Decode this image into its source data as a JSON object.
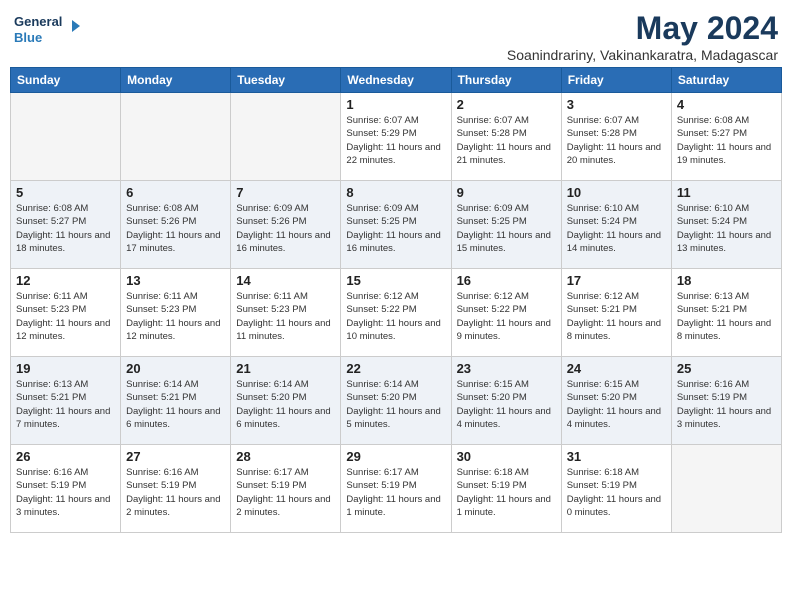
{
  "header": {
    "logo_line1": "General",
    "logo_line2": "Blue",
    "month": "May 2024",
    "location": "Soanindrariny, Vakinankaratra, Madagascar"
  },
  "days_of_week": [
    "Sunday",
    "Monday",
    "Tuesday",
    "Wednesday",
    "Thursday",
    "Friday",
    "Saturday"
  ],
  "weeks": [
    {
      "shade": "odd",
      "days": [
        {
          "num": "",
          "empty": true
        },
        {
          "num": "",
          "empty": true
        },
        {
          "num": "",
          "empty": true
        },
        {
          "num": "1",
          "sunrise": "6:07 AM",
          "sunset": "5:29 PM",
          "daylight": "11 hours and 22 minutes."
        },
        {
          "num": "2",
          "sunrise": "6:07 AM",
          "sunset": "5:28 PM",
          "daylight": "11 hours and 21 minutes."
        },
        {
          "num": "3",
          "sunrise": "6:07 AM",
          "sunset": "5:28 PM",
          "daylight": "11 hours and 20 minutes."
        },
        {
          "num": "4",
          "sunrise": "6:08 AM",
          "sunset": "5:27 PM",
          "daylight": "11 hours and 19 minutes."
        }
      ]
    },
    {
      "shade": "even",
      "days": [
        {
          "num": "5",
          "sunrise": "6:08 AM",
          "sunset": "5:27 PM",
          "daylight": "11 hours and 18 minutes."
        },
        {
          "num": "6",
          "sunrise": "6:08 AM",
          "sunset": "5:26 PM",
          "daylight": "11 hours and 17 minutes."
        },
        {
          "num": "7",
          "sunrise": "6:09 AM",
          "sunset": "5:26 PM",
          "daylight": "11 hours and 16 minutes."
        },
        {
          "num": "8",
          "sunrise": "6:09 AM",
          "sunset": "5:25 PM",
          "daylight": "11 hours and 16 minutes."
        },
        {
          "num": "9",
          "sunrise": "6:09 AM",
          "sunset": "5:25 PM",
          "daylight": "11 hours and 15 minutes."
        },
        {
          "num": "10",
          "sunrise": "6:10 AM",
          "sunset": "5:24 PM",
          "daylight": "11 hours and 14 minutes."
        },
        {
          "num": "11",
          "sunrise": "6:10 AM",
          "sunset": "5:24 PM",
          "daylight": "11 hours and 13 minutes."
        }
      ]
    },
    {
      "shade": "odd",
      "days": [
        {
          "num": "12",
          "sunrise": "6:11 AM",
          "sunset": "5:23 PM",
          "daylight": "11 hours and 12 minutes."
        },
        {
          "num": "13",
          "sunrise": "6:11 AM",
          "sunset": "5:23 PM",
          "daylight": "11 hours and 12 minutes."
        },
        {
          "num": "14",
          "sunrise": "6:11 AM",
          "sunset": "5:23 PM",
          "daylight": "11 hours and 11 minutes."
        },
        {
          "num": "15",
          "sunrise": "6:12 AM",
          "sunset": "5:22 PM",
          "daylight": "11 hours and 10 minutes."
        },
        {
          "num": "16",
          "sunrise": "6:12 AM",
          "sunset": "5:22 PM",
          "daylight": "11 hours and 9 minutes."
        },
        {
          "num": "17",
          "sunrise": "6:12 AM",
          "sunset": "5:21 PM",
          "daylight": "11 hours and 8 minutes."
        },
        {
          "num": "18",
          "sunrise": "6:13 AM",
          "sunset": "5:21 PM",
          "daylight": "11 hours and 8 minutes."
        }
      ]
    },
    {
      "shade": "even",
      "days": [
        {
          "num": "19",
          "sunrise": "6:13 AM",
          "sunset": "5:21 PM",
          "daylight": "11 hours and 7 minutes."
        },
        {
          "num": "20",
          "sunrise": "6:14 AM",
          "sunset": "5:21 PM",
          "daylight": "11 hours and 6 minutes."
        },
        {
          "num": "21",
          "sunrise": "6:14 AM",
          "sunset": "5:20 PM",
          "daylight": "11 hours and 6 minutes."
        },
        {
          "num": "22",
          "sunrise": "6:14 AM",
          "sunset": "5:20 PM",
          "daylight": "11 hours and 5 minutes."
        },
        {
          "num": "23",
          "sunrise": "6:15 AM",
          "sunset": "5:20 PM",
          "daylight": "11 hours and 4 minutes."
        },
        {
          "num": "24",
          "sunrise": "6:15 AM",
          "sunset": "5:20 PM",
          "daylight": "11 hours and 4 minutes."
        },
        {
          "num": "25",
          "sunrise": "6:16 AM",
          "sunset": "5:19 PM",
          "daylight": "11 hours and 3 minutes."
        }
      ]
    },
    {
      "shade": "odd",
      "days": [
        {
          "num": "26",
          "sunrise": "6:16 AM",
          "sunset": "5:19 PM",
          "daylight": "11 hours and 3 minutes."
        },
        {
          "num": "27",
          "sunrise": "6:16 AM",
          "sunset": "5:19 PM",
          "daylight": "11 hours and 2 minutes."
        },
        {
          "num": "28",
          "sunrise": "6:17 AM",
          "sunset": "5:19 PM",
          "daylight": "11 hours and 2 minutes."
        },
        {
          "num": "29",
          "sunrise": "6:17 AM",
          "sunset": "5:19 PM",
          "daylight": "11 hours and 1 minute."
        },
        {
          "num": "30",
          "sunrise": "6:18 AM",
          "sunset": "5:19 PM",
          "daylight": "11 hours and 1 minute."
        },
        {
          "num": "31",
          "sunrise": "6:18 AM",
          "sunset": "5:19 PM",
          "daylight": "11 hours and 0 minutes."
        },
        {
          "num": "",
          "empty": true
        }
      ]
    }
  ]
}
